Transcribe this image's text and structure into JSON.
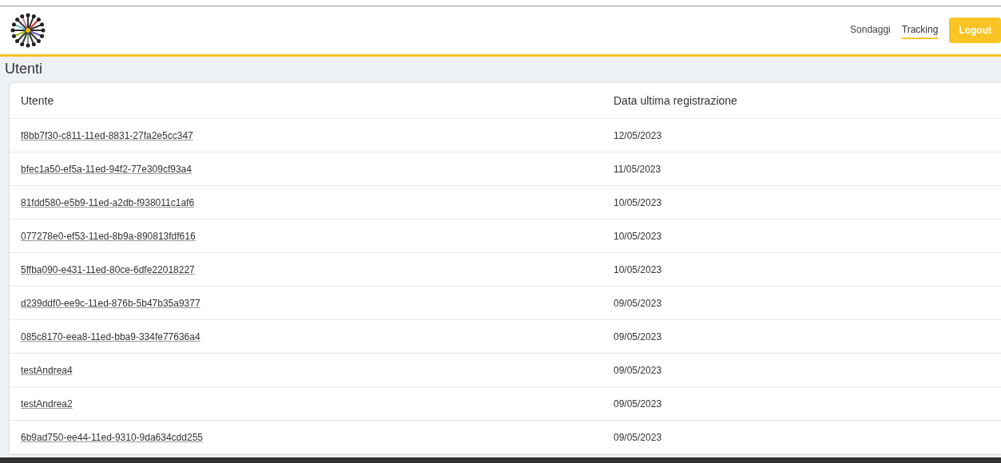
{
  "nav": [
    {
      "label": "Sondaggi",
      "selected": false
    },
    {
      "label": "Tracking",
      "selected": true
    }
  ],
  "logout": "Logout",
  "page_title": "Utenti",
  "table": {
    "columns": [
      "Utente",
      "Data ultima registrazione"
    ],
    "rows": [
      {
        "user": "f8bb7f30-c811-11ed-8831-27fa2e5cc347",
        "date": "12/05/2023"
      },
      {
        "user": "bfec1a50-ef5a-11ed-94f2-77e309cf93a4",
        "date": "11/05/2023"
      },
      {
        "user": "81fdd580-e5b9-11ed-a2db-f938011c1af6",
        "date": "10/05/2023"
      },
      {
        "user": "077278e0-ef53-11ed-8b9a-890813fdf616",
        "date": "10/05/2023"
      },
      {
        "user": "5ffba090-e431-11ed-80ce-6dfe22018227",
        "date": "10/05/2023"
      },
      {
        "user": "d239ddf0-ee9c-11ed-876b-5b47b35a9377",
        "date": "09/05/2023"
      },
      {
        "user": "085c8170-eea8-11ed-bba9-334fe77636a4",
        "date": "09/05/2023"
      },
      {
        "user": "testAndrea4",
        "date": "09/05/2023"
      },
      {
        "user": "testAndrea2",
        "date": "09/05/2023"
      },
      {
        "user": "6b9ad750-ee44-11ed-9310-9da634cdd255",
        "date": "09/05/2023"
      }
    ]
  }
}
